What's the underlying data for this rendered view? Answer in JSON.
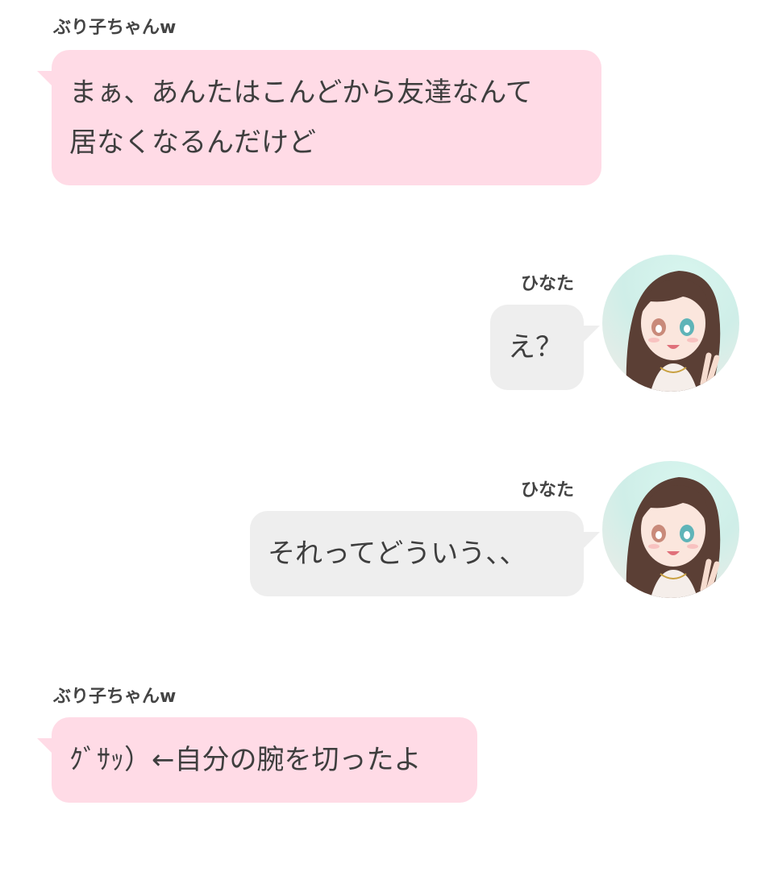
{
  "messages": [
    {
      "side": "left",
      "sender": "ぶり子ちゃんw",
      "lines": [
        "まぁ、あんたはこんどから友達なんて",
        "居なくなるんだけど"
      ]
    },
    {
      "side": "right",
      "sender": "ひなた",
      "text": "え？",
      "avatar": "girl-avatar"
    },
    {
      "side": "right",
      "sender": "ひなた",
      "text": "それってどういう、、",
      "avatar": "girl-avatar"
    },
    {
      "side": "left",
      "sender": "ぶり子ちゃんw",
      "text": "ｸﾞｻｯ）←自分の腕を切ったよ"
    }
  ],
  "colors": {
    "left_bubble": "#ffdbe6",
    "right_bubble": "#eeeeee",
    "text": "#3e3e3e"
  }
}
